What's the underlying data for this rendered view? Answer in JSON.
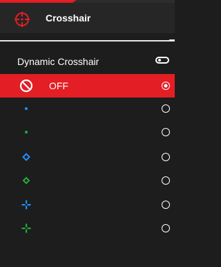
{
  "header": {
    "title": "Crosshair",
    "icon": "crosshair-icon",
    "accent": "#e31e25"
  },
  "dynamic": {
    "label": "Dynamic Crosshair",
    "toggle_on": false
  },
  "options": [
    {
      "id": "off",
      "label": "OFF",
      "icon": "off-icon",
      "selected": true
    },
    {
      "id": "dot-blue",
      "icon": "dot-crosshair-icon",
      "color": "#1e90ff",
      "selected": false
    },
    {
      "id": "dot-green",
      "icon": "dot-crosshair-icon",
      "color": "#1fae3a",
      "selected": false
    },
    {
      "id": "diamond-blue",
      "icon": "diamond-crosshair-icon",
      "color": "#1e90ff",
      "selected": false
    },
    {
      "id": "diamond-green",
      "icon": "diamond-crosshair-icon",
      "color": "#1fae3a",
      "selected": false
    },
    {
      "id": "cross-blue",
      "icon": "cross-crosshair-icon",
      "color": "#1e90ff",
      "selected": false
    },
    {
      "id": "cross-green",
      "icon": "cross-crosshair-icon",
      "color": "#1fae3a",
      "selected": false
    }
  ]
}
